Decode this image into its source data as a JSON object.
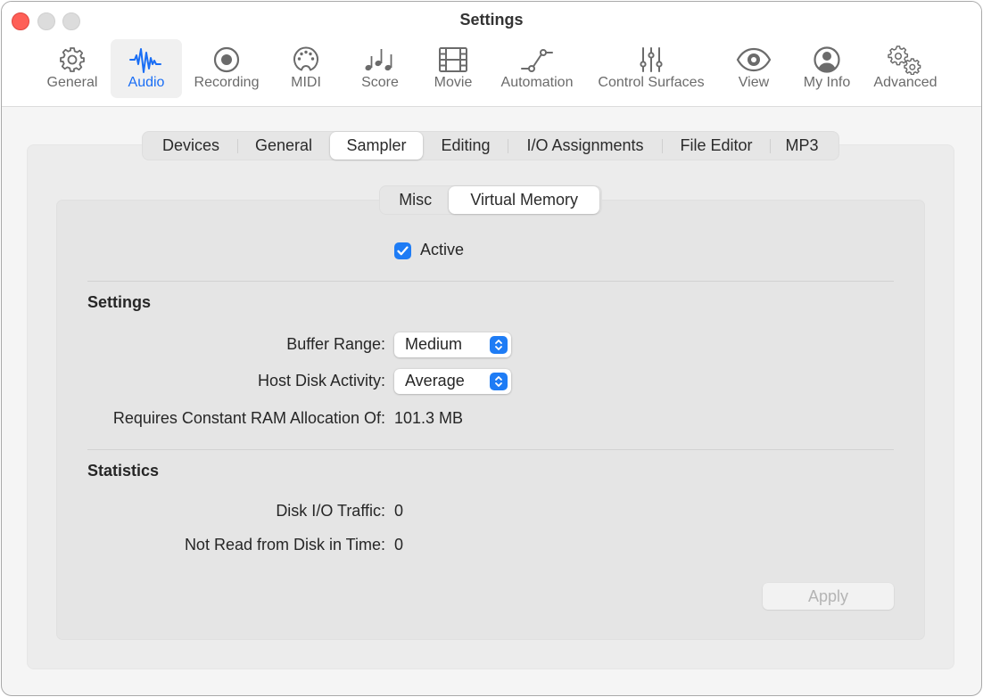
{
  "window": {
    "title": "Settings"
  },
  "toolbar": {
    "items": [
      {
        "label": "General",
        "icon": "gear-icon",
        "active": false
      },
      {
        "label": "Audio",
        "icon": "waveform-icon",
        "active": true
      },
      {
        "label": "Recording",
        "icon": "record-icon",
        "active": false
      },
      {
        "label": "MIDI",
        "icon": "midi-connector-icon",
        "active": false
      },
      {
        "label": "Score",
        "icon": "music-notes-icon",
        "active": false
      },
      {
        "label": "Movie",
        "icon": "film-icon",
        "active": false
      },
      {
        "label": "Automation",
        "icon": "automation-curve-icon",
        "active": false
      },
      {
        "label": "Control Surfaces",
        "icon": "sliders-icon",
        "active": false
      },
      {
        "label": "View",
        "icon": "eye-icon",
        "active": false
      },
      {
        "label": "My Info",
        "icon": "person-circle-icon",
        "active": false
      },
      {
        "label": "Advanced",
        "icon": "gears-icon",
        "active": false
      }
    ],
    "accent_color": "#1a6ef5"
  },
  "tabs": {
    "items": [
      "Devices",
      "General",
      "Sampler",
      "Editing",
      "I/O Assignments",
      "File Editor",
      "MP3"
    ],
    "selected": "Sampler"
  },
  "subtabs": {
    "items": [
      "Misc",
      "Virtual Memory"
    ],
    "selected": "Virtual Memory"
  },
  "virtual_memory": {
    "active_label": "Active",
    "active_checked": true,
    "settings_title": "Settings",
    "buffer_range_label": "Buffer Range:",
    "buffer_range_value": "Medium",
    "host_disk_label": "Host Disk Activity:",
    "host_disk_value": "Average",
    "ram_label": "Requires Constant RAM Allocation Of:",
    "ram_value": "101.3 MB",
    "statistics_title": "Statistics",
    "disk_io_label": "Disk I/O Traffic:",
    "disk_io_value": "0",
    "not_read_label": "Not Read from Disk in Time:",
    "not_read_value": "0",
    "apply_label": "Apply",
    "apply_enabled": false
  }
}
